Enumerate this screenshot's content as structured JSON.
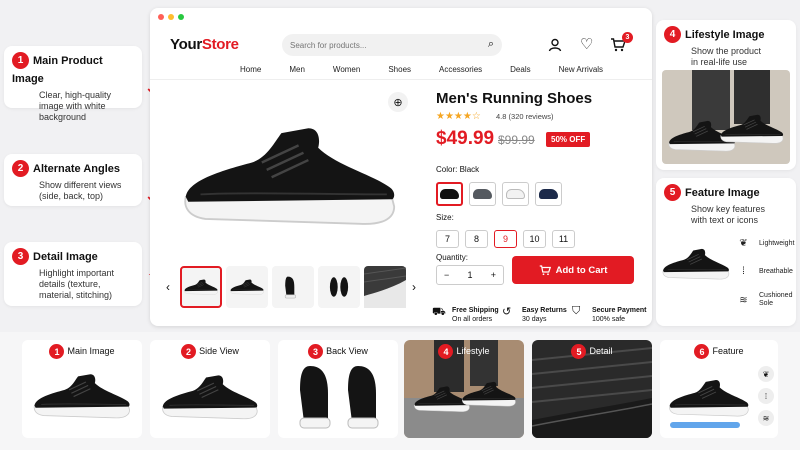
{
  "callouts_left": [
    {
      "num": "1",
      "title": "Main Product Image",
      "desc": [
        "Clear, high-quality",
        "image with white",
        "background"
      ]
    },
    {
      "num": "2",
      "title": "Alternate Angles",
      "desc": [
        "Show different views",
        "(side, back, top)"
      ]
    },
    {
      "num": "3",
      "title": "Detail Image",
      "desc": [
        "Highlight important",
        "details (texture,",
        "material, stitching)"
      ]
    }
  ],
  "callouts_right": [
    {
      "num": "4",
      "title": "Lifestyle Image",
      "desc": [
        "Show the product",
        "in real-life use"
      ]
    },
    {
      "num": "5",
      "title": "Feature Image",
      "desc": [
        "Show key features",
        "with text or icons"
      ]
    }
  ],
  "feature_labels": [
    "Lightweight",
    "Breathable",
    "Cushioned Sole"
  ],
  "store": {
    "logo_your": "Your",
    "logo_store": "Store",
    "search_placeholder": "Search for products...",
    "cart_count": "3",
    "nav": [
      "Home",
      "Men",
      "Women",
      "Shoes",
      "Accessories",
      "Deals",
      "New Arrivals"
    ]
  },
  "product": {
    "title": "Men's Running Shoes",
    "stars": "★★★★☆",
    "rating": "4.8",
    "reviews": "(320 reviews)",
    "price": "$49.99",
    "old_price": "$99.99",
    "discount": "50% OFF",
    "color_label": "Color:",
    "color_value": "Black",
    "size_label": "Size:",
    "sizes": [
      "7",
      "8",
      "9",
      "10",
      "11"
    ],
    "selected_size": "9",
    "quantity_label": "Quantity:",
    "quantity": "1",
    "add_to_cart": "Add to Cart",
    "colors": [
      "#111111",
      "#555a60",
      "#f2f2f2",
      "#1c2a4a"
    ]
  },
  "services": [
    {
      "title": "Free Shipping",
      "sub": "On all orders"
    },
    {
      "title": "Easy Returns",
      "sub": "30 days"
    },
    {
      "title": "Secure Payment",
      "sub": "100% safe"
    }
  ],
  "cards": [
    {
      "num": "1",
      "label": "Main Image"
    },
    {
      "num": "2",
      "label": "Side View"
    },
    {
      "num": "3",
      "label": "Back View"
    },
    {
      "num": "4",
      "label": "Lifestyle"
    },
    {
      "num": "5",
      "label": "Detail"
    },
    {
      "num": "6",
      "label": "Feature"
    }
  ],
  "colors": {
    "accent": "#e21b23",
    "brand_dark": "#111111"
  }
}
